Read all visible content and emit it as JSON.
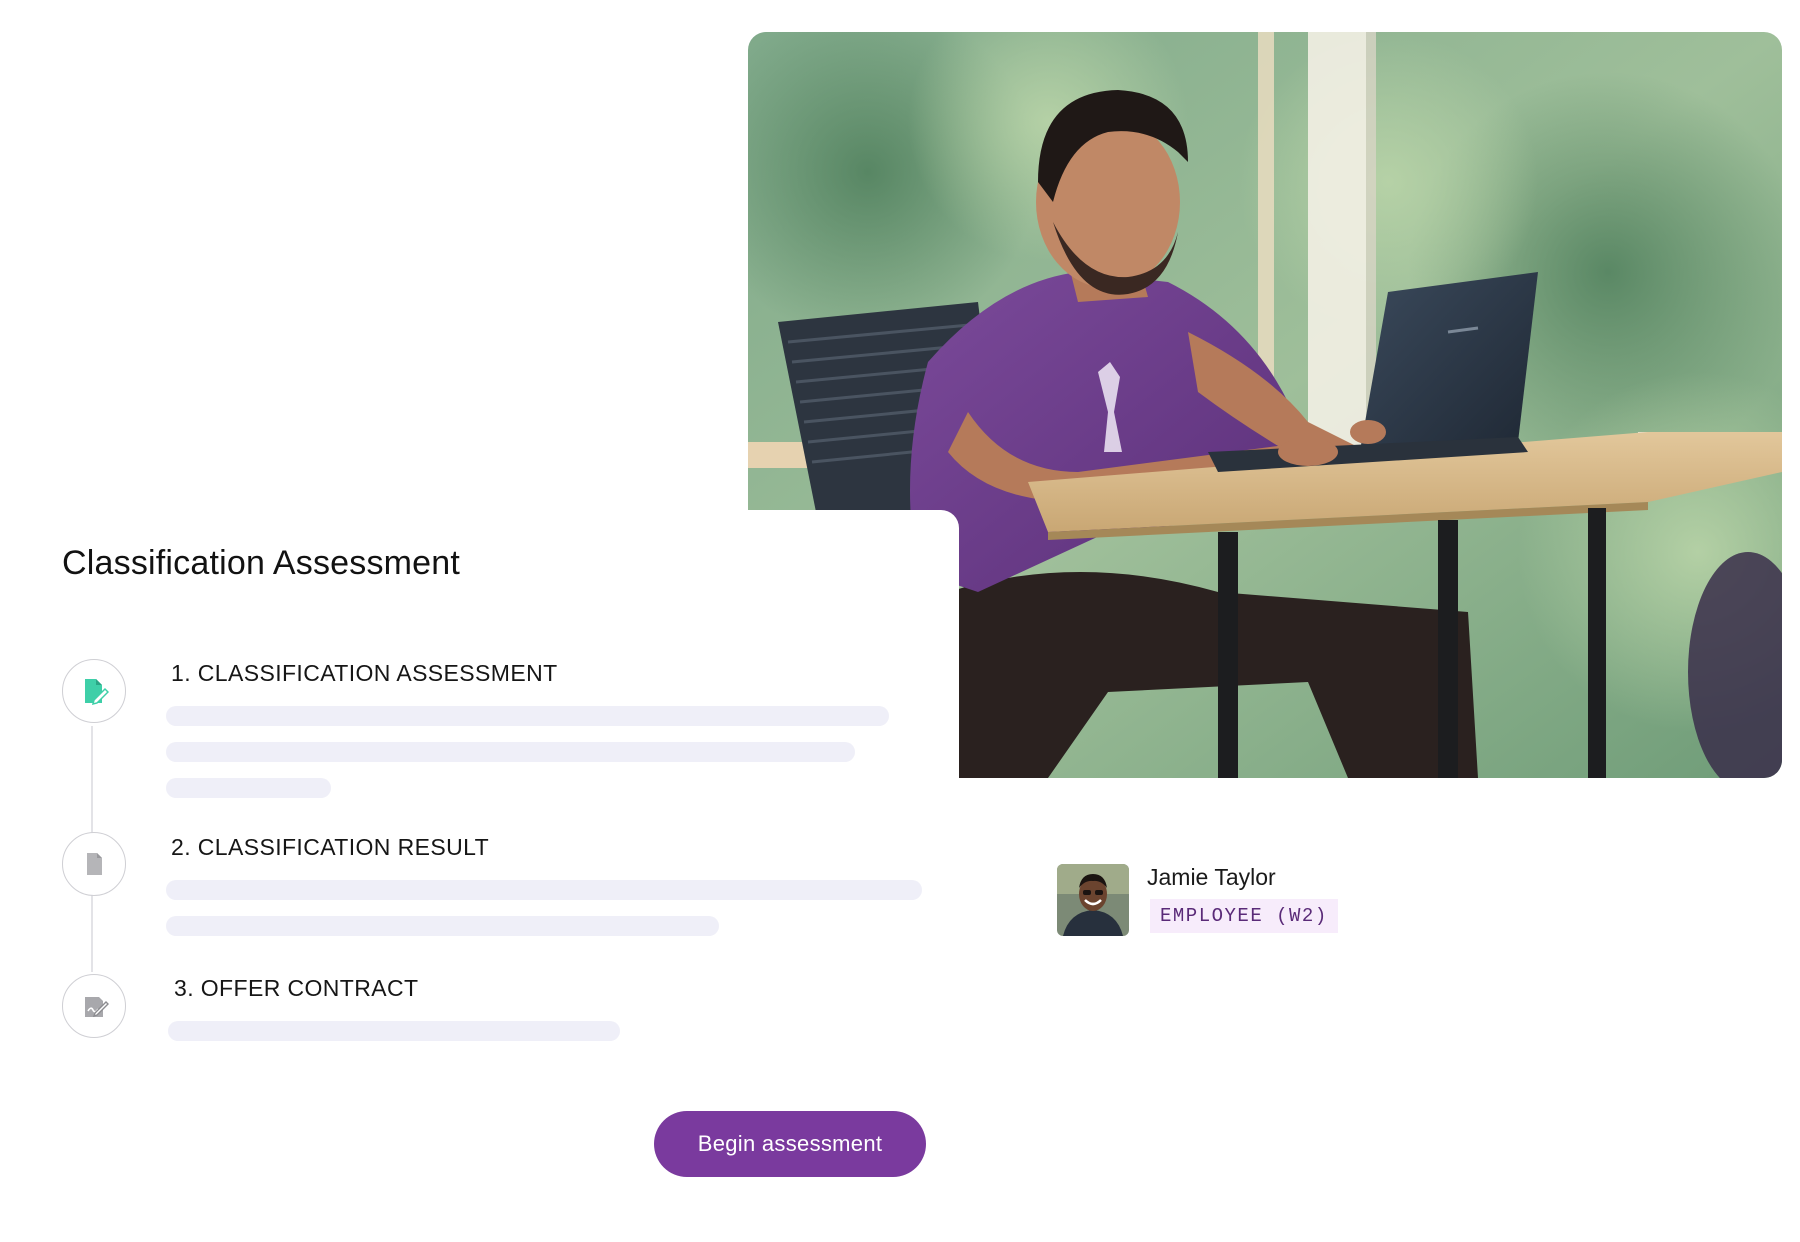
{
  "assessment": {
    "title": "Classification Assessment",
    "steps": [
      {
        "label": "1. CLASSIFICATION ASSESSMENT",
        "icon": "document-edit-icon",
        "icon_color": "#3ecfa8"
      },
      {
        "label": "2. CLASSIFICATION RESULT",
        "icon": "document-icon",
        "icon_color": "#b5b5b8"
      },
      {
        "label": "3. OFFER CONTRACT",
        "icon": "contract-sign-icon",
        "icon_color": "#9a9a9e"
      }
    ],
    "primary_button": {
      "label": "Begin assessment"
    }
  },
  "person": {
    "name": "Jamie Taylor",
    "badge": "EMPLOYEE (W2)"
  },
  "hero_image": {
    "description_icon": "photo-man-at-laptop"
  },
  "colors": {
    "brand_purple": "#7a3a9e",
    "skeleton": "#efeff8",
    "badge_bg": "#f7ecfb",
    "badge_text": "#5a2a78"
  }
}
